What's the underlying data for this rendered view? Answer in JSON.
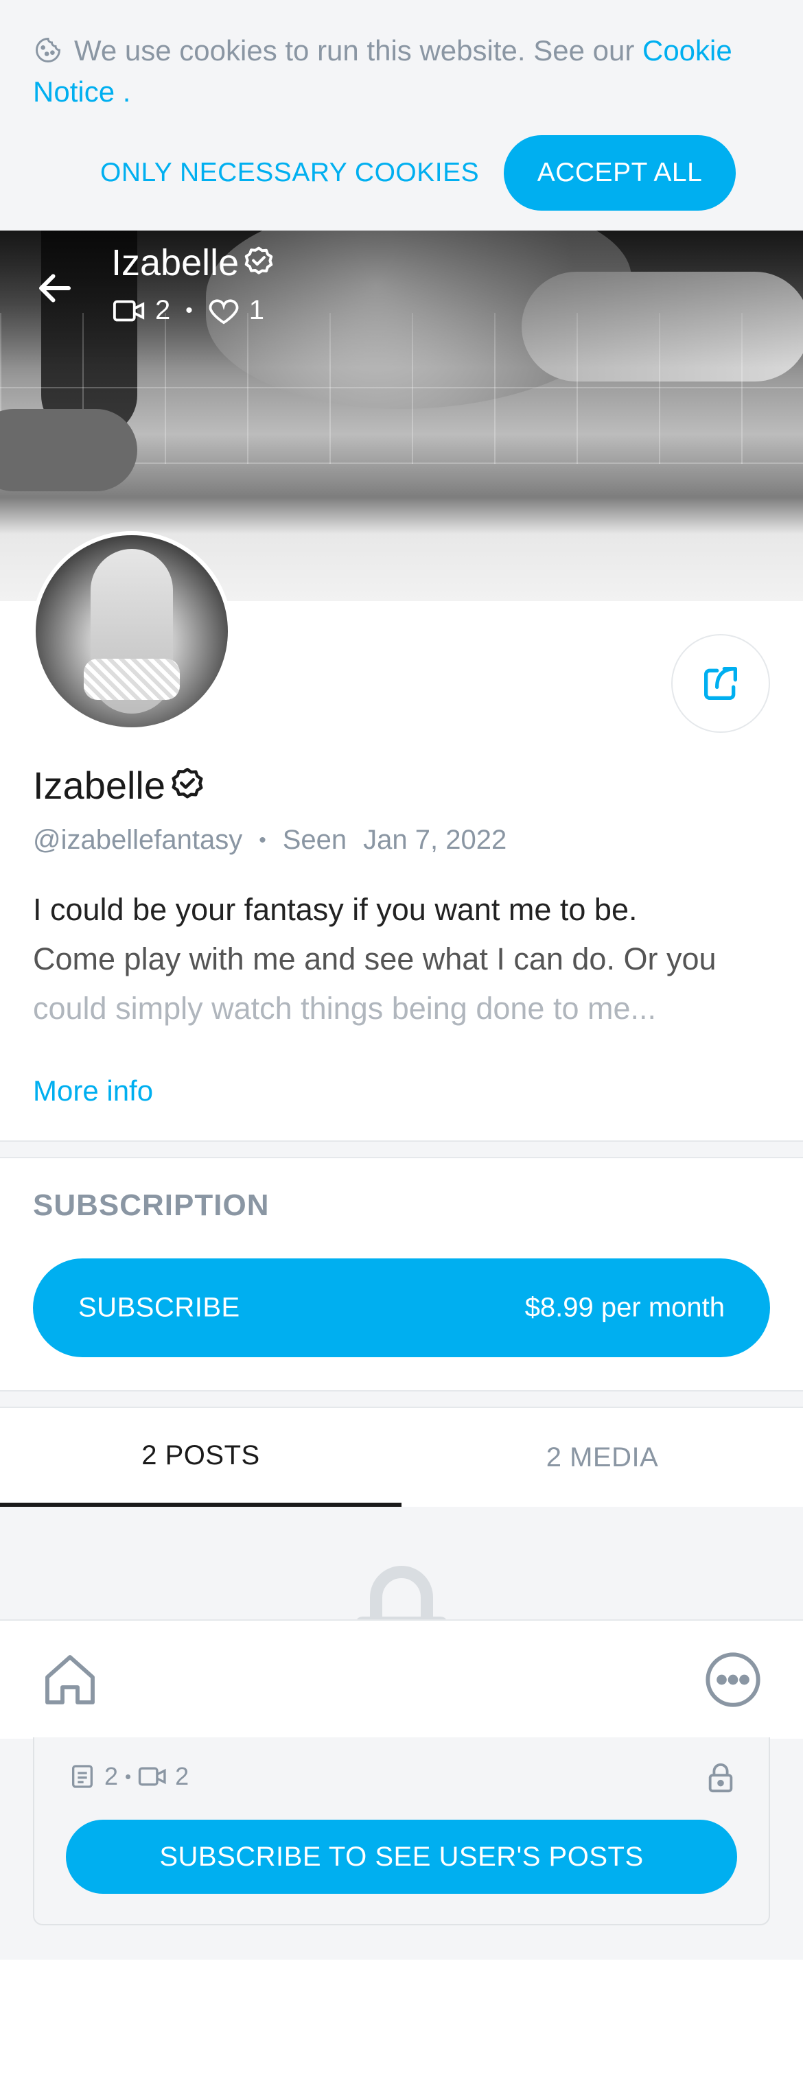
{
  "cookie": {
    "text": "We use cookies to run this website. See our ",
    "link": "Cookie Notice",
    "suffix": " .",
    "necessary_label": "ONLY NECESSARY COOKIES",
    "accept_label": "ACCEPT ALL"
  },
  "header": {
    "name": "Izabelle",
    "videos": "2",
    "likes": "1"
  },
  "profile": {
    "name": "Izabelle",
    "handle": "@izabellefantasy",
    "seen_label": "Seen",
    "seen_date": "Jan 7, 2022",
    "bio_lines": [
      "I could be your fantasy if you want me to be.",
      "Come play with me and see what I can do. Or you",
      "could simply watch things being done to me..."
    ],
    "more_info": "More info"
  },
  "subscription": {
    "title": "SUBSCRIPTION",
    "button_label": "SUBSCRIBE",
    "price": "$8.99 per month"
  },
  "tabs": [
    {
      "label": "2 POSTS",
      "active": true
    },
    {
      "label": "2 MEDIA",
      "active": false
    }
  ],
  "post_card": {
    "posts": "2",
    "videos": "2",
    "button_label": "SUBSCRIBE TO SEE USER'S POSTS"
  },
  "colors": {
    "accent": "#00aff0",
    "muted": "#8a96a3",
    "background_gray": "#f4f5f7"
  },
  "icons": {
    "cookie": "cookie-icon",
    "back": "arrow-left-icon",
    "verified": "verified-badge-icon",
    "video": "video-camera-icon",
    "heart": "heart-icon",
    "share": "share-icon",
    "lock": "lock-icon",
    "home": "home-icon",
    "more": "more-dots-icon",
    "posts": "document-icon"
  }
}
